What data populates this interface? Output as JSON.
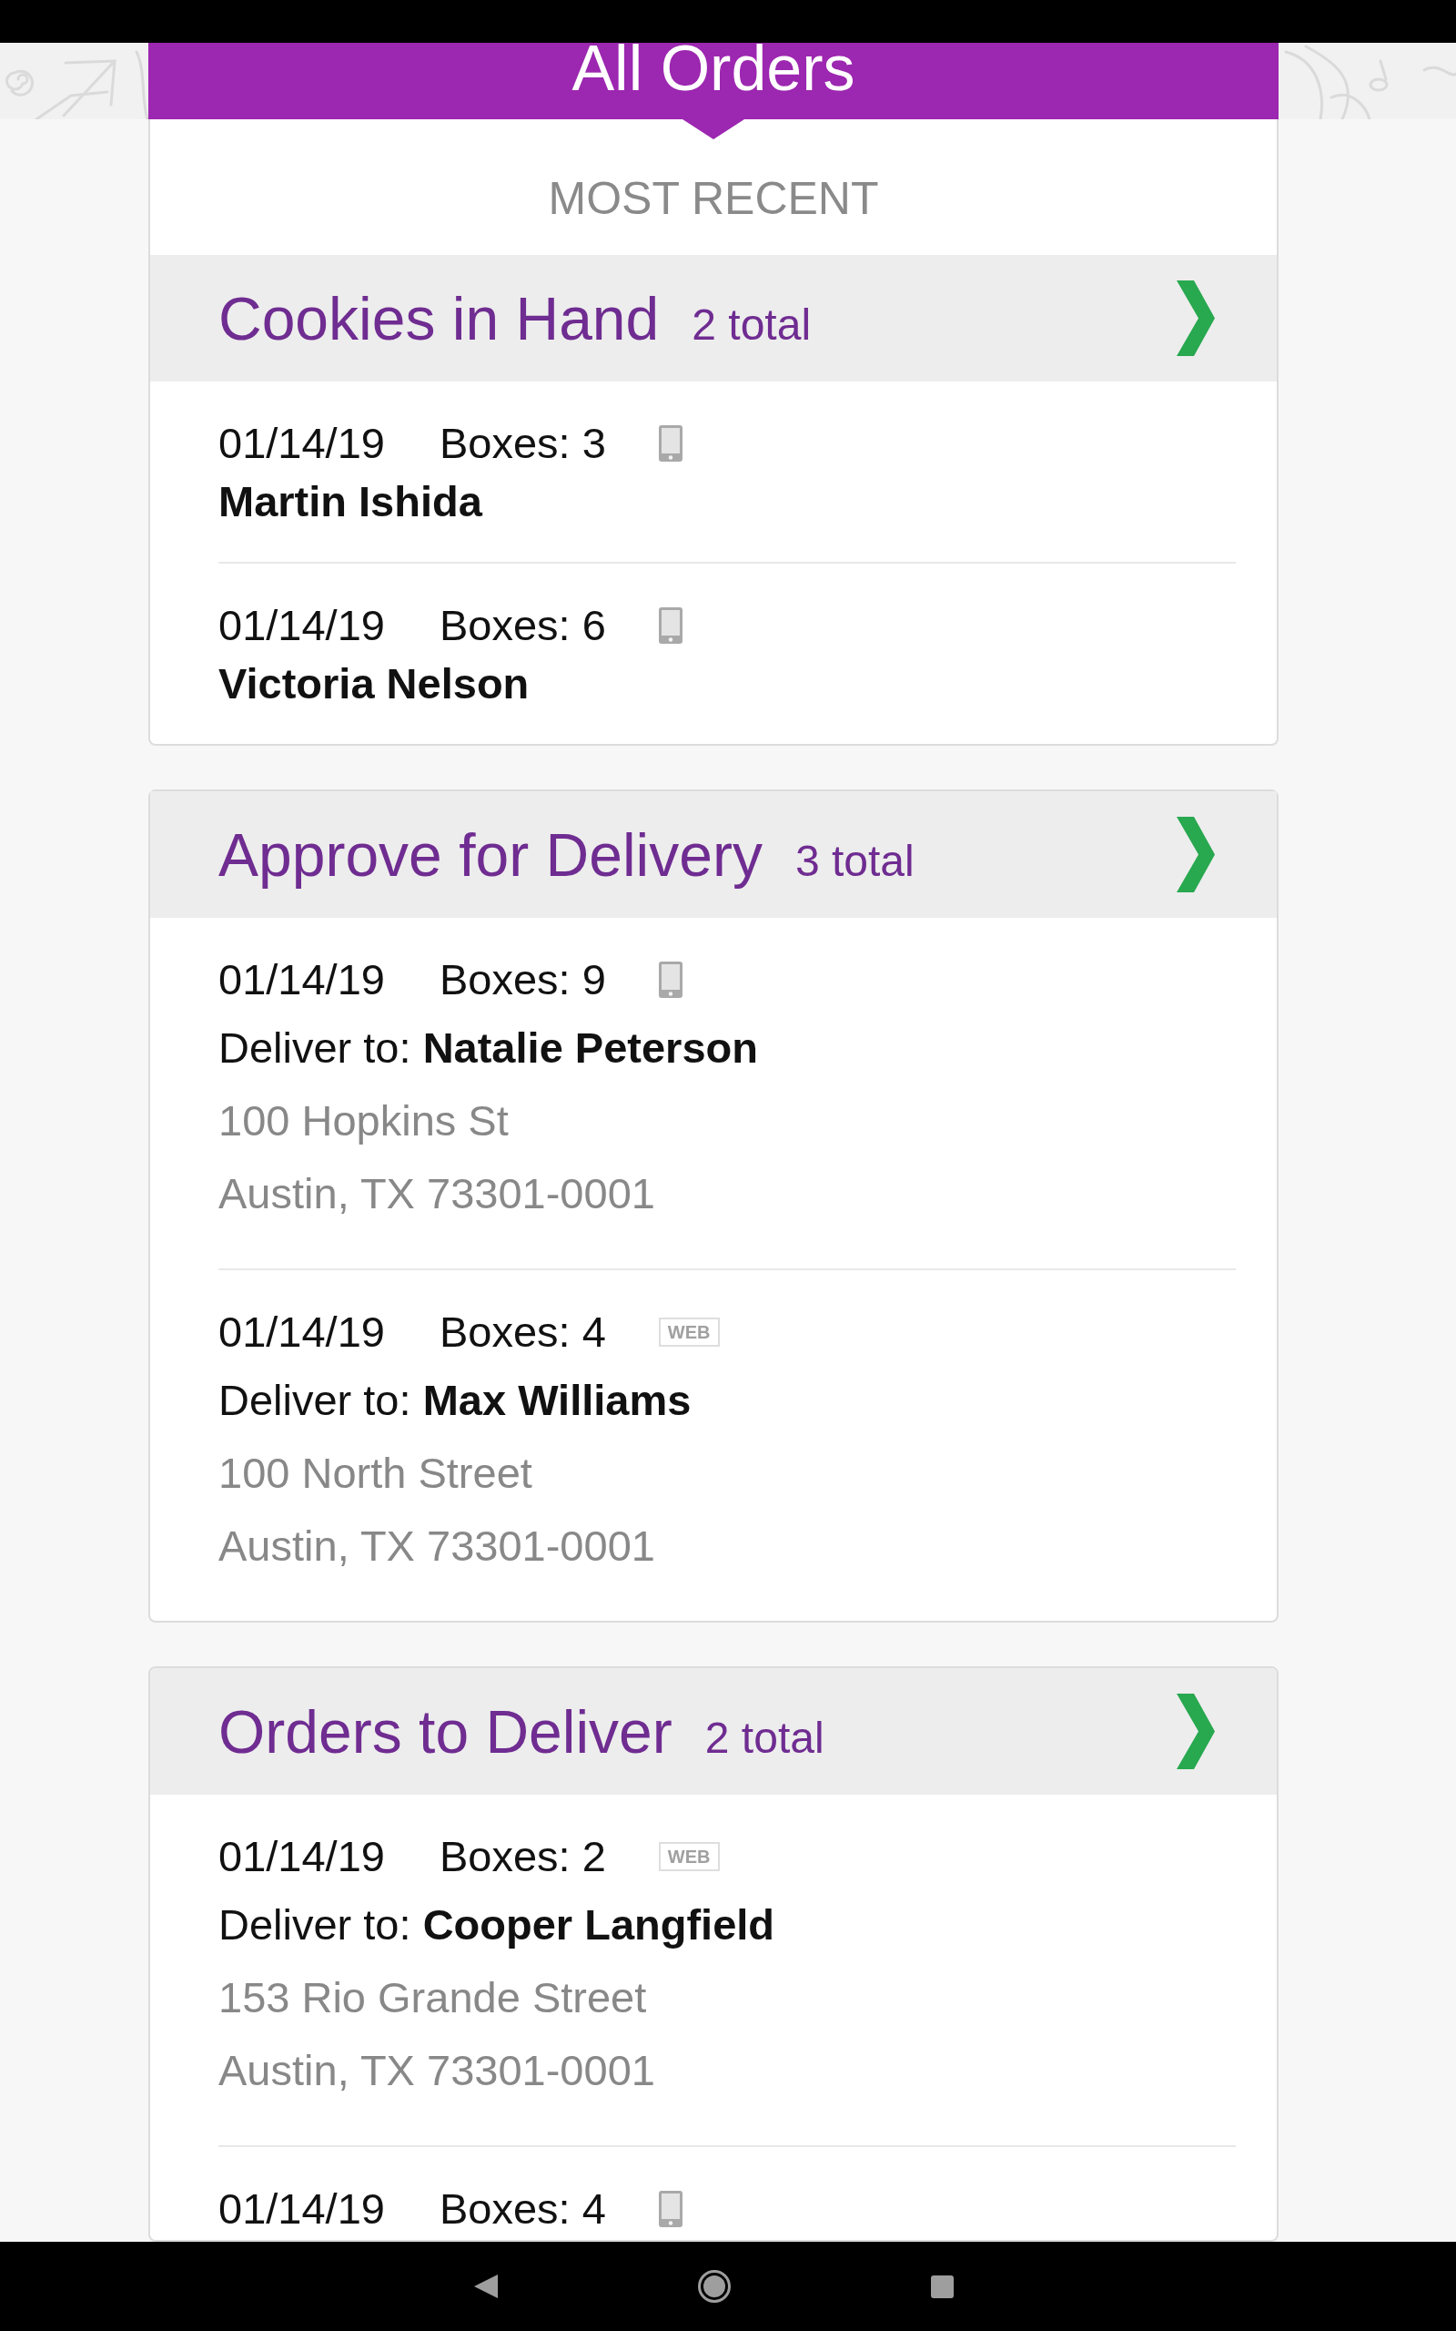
{
  "header": {
    "title": "All Orders"
  },
  "filter": {
    "label": "MOST RECENT"
  },
  "groups": [
    {
      "title": "Cookies in Hand",
      "count": "2 total",
      "orders": [
        {
          "kind": "in_hand",
          "date": "01/14/19",
          "boxes": "Boxes: 3",
          "channel": {
            "kind": "phone"
          },
          "name": "Martin Ishida"
        },
        {
          "kind": "in_hand",
          "date": "01/14/19",
          "boxes": "Boxes: 6",
          "channel": {
            "kind": "phone"
          },
          "name": "Victoria Nelson"
        }
      ]
    },
    {
      "title": "Approve for Delivery",
      "count": "3 total",
      "orders": [
        {
          "kind": "delivery",
          "date": "01/14/19",
          "boxes": "Boxes: 9",
          "channel": {
            "kind": "phone"
          },
          "recipient": "Deliver to: **Natalie Peterson**",
          "address": [
            "100 Hopkins St",
            "Austin, TX 73301-0001"
          ]
        },
        {
          "kind": "delivery",
          "date": "01/14/19",
          "boxes": "Boxes: 4",
          "channel": {
            "kind": "web",
            "label": "WEB"
          },
          "recipient": "Deliver to: **Max Williams**",
          "address": [
            "100 North Street",
            "Austin, TX 73301-0001"
          ]
        }
      ]
    },
    {
      "title": "Orders to Deliver",
      "count": "2 total",
      "orders": [
        {
          "kind": "delivery",
          "date": "01/14/19",
          "boxes": "Boxes: 2",
          "channel": {
            "kind": "web",
            "label": "WEB"
          },
          "recipient": "Deliver to: **Cooper Langfield**",
          "address": [
            "153 Rio Grande Street",
            "Austin, TX 73301-0001"
          ]
        },
        {
          "kind": "delivery",
          "date": "01/14/19",
          "boxes": "Boxes: 4",
          "channel": {
            "kind": "phone"
          }
        }
      ]
    }
  ]
}
